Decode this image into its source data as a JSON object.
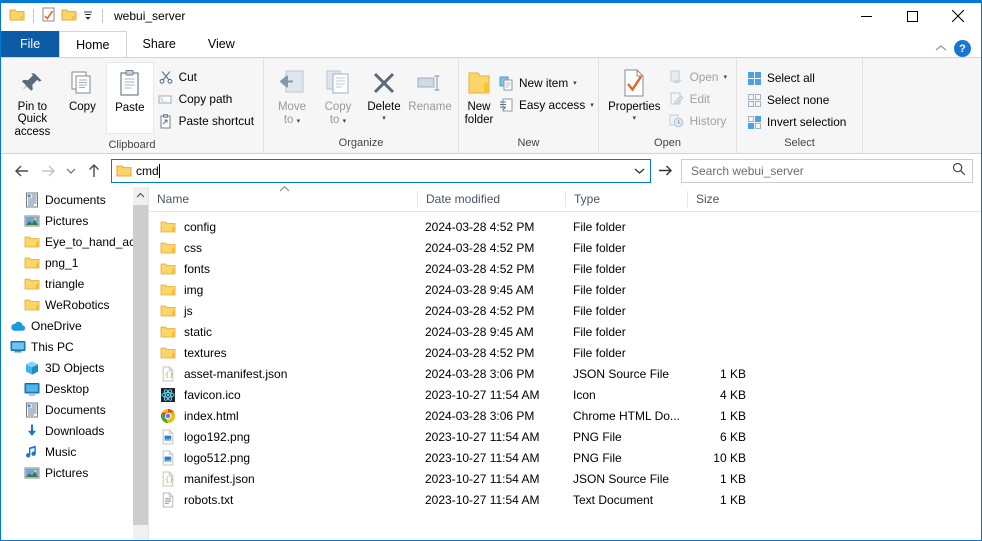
{
  "window": {
    "title": "webui_server",
    "quick_access": [
      {
        "name": "qat-folder-icon",
        "label": "Folder"
      },
      {
        "name": "qat-properties-icon",
        "label": "Properties"
      },
      {
        "name": "qat-new-folder-icon",
        "label": "New folder"
      },
      {
        "name": "qat-customize-icon",
        "label": "Customize Quick Access Toolbar"
      }
    ],
    "controls": {
      "minimize": "—",
      "maximize": "☐",
      "close": "✕"
    }
  },
  "tabs": [
    {
      "label": "File",
      "active": false,
      "kind": "file"
    },
    {
      "label": "Home",
      "active": true,
      "kind": "normal"
    },
    {
      "label": "Share",
      "active": false,
      "kind": "normal"
    },
    {
      "label": "View",
      "active": false,
      "kind": "normal"
    }
  ],
  "tabstrip_right": {
    "collapse_ribbon": "⌃",
    "help": "?"
  },
  "ribbon": {
    "groups": [
      {
        "label": "Clipboard",
        "big_buttons": [
          {
            "name": "pin-to-quick-access-button",
            "line1": "Pin to Quick",
            "line2": "access",
            "icon": "pin-icon",
            "disabled": false
          },
          {
            "name": "copy-button",
            "line1": "Copy",
            "line2": "",
            "icon": "copy-icon",
            "disabled": false
          },
          {
            "name": "paste-button",
            "line1": "Paste",
            "line2": "",
            "icon": "paste-icon",
            "disabled": false
          }
        ],
        "small_buttons": [
          {
            "name": "cut-button",
            "label": "Cut",
            "icon": "scissors-icon",
            "disabled": false
          },
          {
            "name": "copy-path-button",
            "label": "Copy path",
            "icon": "copy-path-icon",
            "disabled": false
          },
          {
            "name": "paste-shortcut-button",
            "label": "Paste shortcut",
            "icon": "paste-shortcut-icon",
            "disabled": false
          }
        ]
      },
      {
        "label": "Organize",
        "big_buttons": [
          {
            "name": "move-to-button",
            "line1": "Move",
            "line2": "to",
            "icon": "move-to-icon",
            "disabled": true,
            "dropdown": true
          },
          {
            "name": "copy-to-button",
            "line1": "Copy",
            "line2": "to",
            "icon": "copy-to-icon",
            "disabled": true,
            "dropdown": true
          },
          {
            "name": "delete-button",
            "line1": "Delete",
            "line2": "",
            "icon": "delete-icon",
            "disabled": false,
            "dropdown": true
          },
          {
            "name": "rename-button",
            "line1": "Rename",
            "line2": "",
            "icon": "rename-icon",
            "disabled": true
          }
        ],
        "small_buttons": []
      },
      {
        "label": "New",
        "big_buttons": [
          {
            "name": "new-folder-button",
            "line1": "New",
            "line2": "folder",
            "icon": "new-folder-icon",
            "disabled": false
          }
        ],
        "small_buttons": [
          {
            "name": "new-item-button",
            "label": "New item",
            "icon": "new-item-icon",
            "disabled": false,
            "dropdown": true
          },
          {
            "name": "easy-access-button",
            "label": "Easy access",
            "icon": "easy-access-icon",
            "disabled": false,
            "dropdown": true
          }
        ]
      },
      {
        "label": "Open",
        "big_buttons": [
          {
            "name": "properties-button",
            "line1": "Properties",
            "line2": "",
            "icon": "properties-icon",
            "disabled": false,
            "dropdown": true
          }
        ],
        "small_buttons": [
          {
            "name": "open-button",
            "label": "Open",
            "icon": "open-icon",
            "disabled": true,
            "dropdown": true
          },
          {
            "name": "edit-button",
            "label": "Edit",
            "icon": "edit-icon",
            "disabled": true
          },
          {
            "name": "history-button",
            "label": "History",
            "icon": "history-icon",
            "disabled": true
          }
        ]
      },
      {
        "label": "Select",
        "big_buttons": [],
        "small_buttons": [
          {
            "name": "select-all-button",
            "label": "Select all",
            "icon": "select-all-icon",
            "disabled": false
          },
          {
            "name": "select-none-button",
            "label": "Select none",
            "icon": "select-none-icon",
            "disabled": false
          },
          {
            "name": "invert-selection-button",
            "label": "Invert selection",
            "icon": "invert-selection-icon",
            "disabled": false
          }
        ]
      }
    ]
  },
  "address": {
    "back": "←",
    "forward": "→",
    "recent": "⌄",
    "up": "↑",
    "path_value": "cmd",
    "dropdown": "⌄",
    "go": "→",
    "search_placeholder": "Search webui_server",
    "search_value": ""
  },
  "sidebar": {
    "items": [
      {
        "label": "Documents",
        "icon": "documents-icon",
        "indent": 1,
        "pinned": true
      },
      {
        "label": "Pictures",
        "icon": "pictures-icon",
        "indent": 1,
        "pinned": true
      },
      {
        "label": "Eye_to_hand_acc",
        "icon": "folder-icon",
        "indent": 1,
        "pinned": false
      },
      {
        "label": "png_1",
        "icon": "folder-icon",
        "indent": 1,
        "pinned": false
      },
      {
        "label": "triangle",
        "icon": "folder-icon",
        "indent": 1,
        "pinned": false
      },
      {
        "label": "WeRobotics",
        "icon": "folder-icon",
        "indent": 1,
        "pinned": false
      },
      {
        "label": "OneDrive",
        "icon": "onedrive-icon",
        "indent": 0,
        "pinned": false
      },
      {
        "label": "This PC",
        "icon": "this-pc-icon",
        "indent": 0,
        "pinned": false
      },
      {
        "label": "3D Objects",
        "icon": "3d-objects-icon",
        "indent": 1,
        "pinned": false
      },
      {
        "label": "Desktop",
        "icon": "desktop-icon",
        "indent": 1,
        "pinned": false
      },
      {
        "label": "Documents",
        "icon": "documents-icon",
        "indent": 1,
        "pinned": false
      },
      {
        "label": "Downloads",
        "icon": "downloads-icon",
        "indent": 1,
        "pinned": false
      },
      {
        "label": "Music",
        "icon": "music-icon",
        "indent": 1,
        "pinned": false
      },
      {
        "label": "Pictures",
        "icon": "pictures-icon",
        "indent": 1,
        "pinned": false
      }
    ],
    "scroll_up_arrow": "⌃"
  },
  "filelist": {
    "columns": [
      {
        "label": "Name",
        "key": "name"
      },
      {
        "label": "Date modified",
        "key": "date"
      },
      {
        "label": "Type",
        "key": "type"
      },
      {
        "label": "Size",
        "key": "size"
      }
    ],
    "sort_indicator": "⌃",
    "rows": [
      {
        "name": "config",
        "date": "2024-03-28 4:52 PM",
        "type": "File folder",
        "size": "",
        "icon": "folder-icon"
      },
      {
        "name": "css",
        "date": "2024-03-28 4:52 PM",
        "type": "File folder",
        "size": "",
        "icon": "folder-icon"
      },
      {
        "name": "fonts",
        "date": "2024-03-28 4:52 PM",
        "type": "File folder",
        "size": "",
        "icon": "folder-icon"
      },
      {
        "name": "img",
        "date": "2024-03-28 9:45 AM",
        "type": "File folder",
        "size": "",
        "icon": "folder-icon"
      },
      {
        "name": "js",
        "date": "2024-03-28 4:52 PM",
        "type": "File folder",
        "size": "",
        "icon": "folder-icon"
      },
      {
        "name": "static",
        "date": "2024-03-28 9:45 AM",
        "type": "File folder",
        "size": "",
        "icon": "folder-icon"
      },
      {
        "name": "textures",
        "date": "2024-03-28 4:52 PM",
        "type": "File folder",
        "size": "",
        "icon": "folder-icon"
      },
      {
        "name": "asset-manifest.json",
        "date": "2024-03-28 3:06 PM",
        "type": "JSON Source File",
        "size": "1 KB",
        "icon": "json-file-icon"
      },
      {
        "name": "favicon.ico",
        "date": "2023-10-27 11:54 AM",
        "type": "Icon",
        "size": "4 KB",
        "icon": "react-icon-file-icon"
      },
      {
        "name": "index.html",
        "date": "2024-03-28 3:06 PM",
        "type": "Chrome HTML Do...",
        "size": "1 KB",
        "icon": "chrome-icon"
      },
      {
        "name": "logo192.png",
        "date": "2023-10-27 11:54 AM",
        "type": "PNG File",
        "size": "6 KB",
        "icon": "png-file-icon"
      },
      {
        "name": "logo512.png",
        "date": "2023-10-27 11:54 AM",
        "type": "PNG File",
        "size": "10 KB",
        "icon": "png-file-icon"
      },
      {
        "name": "manifest.json",
        "date": "2023-10-27 11:54 AM",
        "type": "JSON Source File",
        "size": "1 KB",
        "icon": "json-file-icon"
      },
      {
        "name": "robots.txt",
        "date": "2023-10-27 11:54 AM",
        "type": "Text Document",
        "size": "1 KB",
        "icon": "text-file-icon"
      }
    ]
  },
  "colors": {
    "accent": "#0078d7",
    "file_tab": "#0d5ba6",
    "folder_yellow": "#fcd568",
    "ribbon_bg": "#f6f6f6"
  }
}
